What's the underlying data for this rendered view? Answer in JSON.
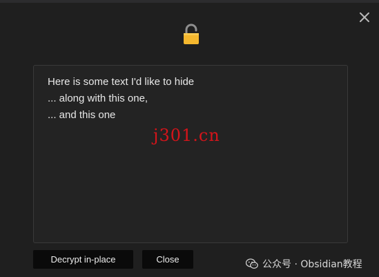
{
  "background_title": "",
  "dialog": {
    "close_icon": "close-icon",
    "lock_icon": "unlocked-padlock-icon",
    "lines": [
      "Here is some text I'd like to hide",
      "... along with this one,",
      "... and this one"
    ]
  },
  "watermark": {
    "site": "j301.cn",
    "wechat": "公众号 · Obsidian教程"
  },
  "buttons": {
    "decrypt_label": "Decrypt in-place",
    "close_label": "Close"
  },
  "colors": {
    "background": "#1f1f1f",
    "textarea": "#232323",
    "button": "#0a0a0a",
    "lock_body": "#f5b82e",
    "watermark": "#d5141a"
  }
}
